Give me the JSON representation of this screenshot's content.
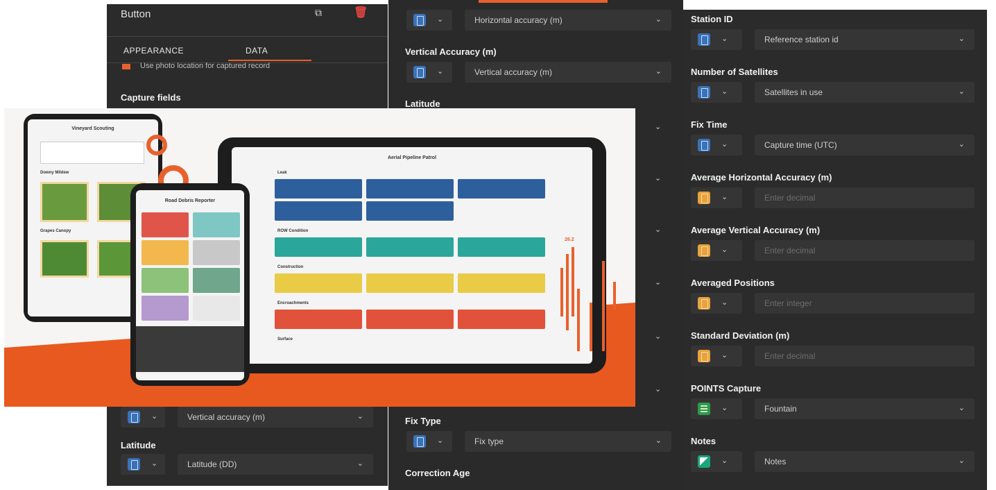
{
  "left_panel": {
    "title": "Button",
    "tabs": [
      "APPEARANCE",
      "DATA"
    ],
    "active_tab": "DATA",
    "checkbox_label": "Use photo location for captured record",
    "capture_fields_label": "Capture fields",
    "rows": [
      {
        "type_icon": "device-icon",
        "select": "Vertical accuracy (m)"
      },
      {
        "label": "Latitude",
        "type_icon": "device-icon",
        "select": "Latitude (DD)"
      }
    ]
  },
  "mid_panel": {
    "fields": [
      {
        "label": "",
        "type_icon": "device-icon",
        "select": "Horizontal accuracy (m)"
      },
      {
        "label": "Vertical Accuracy (m)",
        "type_icon": "device-icon",
        "select": "Vertical accuracy (m)"
      },
      {
        "label": "Latitude"
      },
      {
        "label": "Fix Type",
        "type_icon": "device-icon",
        "select": "Fix type"
      },
      {
        "label": "Correction Age"
      }
    ]
  },
  "right_panel": {
    "fields": [
      {
        "label": "Station ID",
        "type_icon": "device-icon",
        "icon_color": "blue",
        "select": "Reference station id",
        "placeholder": false
      },
      {
        "label": "Number of Satellites",
        "type_icon": "device-icon",
        "icon_color": "blue",
        "select": "Satellites in use",
        "placeholder": false
      },
      {
        "label": "Fix Time",
        "type_icon": "device-icon",
        "icon_color": "blue",
        "select": "Capture time (UTC)",
        "placeholder": false
      },
      {
        "label": "Average Horizontal Accuracy (m)",
        "type_icon": "number-icon",
        "icon_color": "orange",
        "select": "Enter decimal",
        "placeholder": true
      },
      {
        "label": "Average Vertical Accuracy (m)",
        "type_icon": "number-icon",
        "icon_color": "orange",
        "select": "Enter decimal",
        "placeholder": true
      },
      {
        "label": "Averaged Positions",
        "type_icon": "number-icon",
        "icon_color": "orange",
        "select": "Enter integer",
        "placeholder": true
      },
      {
        "label": "Standard Deviation (m)",
        "type_icon": "number-icon",
        "icon_color": "orange",
        "select": "Enter decimal",
        "placeholder": true
      },
      {
        "label": "POINTS Capture",
        "type_icon": "list-icon",
        "icon_color": "green",
        "select": "Fountain",
        "placeholder": false
      },
      {
        "label": "Notes",
        "type_icon": "notes-icon",
        "icon_color": "teal",
        "select": "Notes",
        "placeholder": false
      }
    ]
  },
  "promo": {
    "tablet_left_title": "Vineyard Scouting",
    "tablet_left_sections": [
      "Downy Mildew",
      "Grapes Canopy"
    ],
    "phone_title": "Road Debris Reporter",
    "tablet_right_title": "Aerial Pipeline Patrol",
    "tablet_right_sections": [
      "Leak",
      "ROW Condition",
      "Construction",
      "Encroachments",
      "Surface"
    ],
    "readout": "26.2"
  },
  "colors": {
    "accent": "#e8612c",
    "panel_bg": "#2b2b2b",
    "field_bg": "#353535",
    "blue": "#3a72b8",
    "orange": "#e8a33c",
    "green": "#2f9a4a",
    "teal": "#1ba57c"
  }
}
